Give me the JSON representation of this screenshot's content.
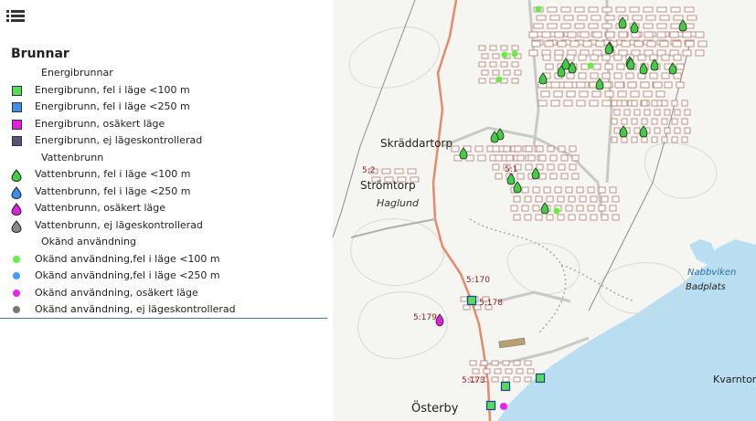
{
  "legend": {
    "title": "Brunnar",
    "items": [
      {
        "kind": "group",
        "label": "Energibrunnar"
      },
      {
        "kind": "square",
        "color": "#55dd55",
        "label": "Energibrunn, fel i läge <100 m"
      },
      {
        "kind": "square",
        "color": "#3d8ef0",
        "label": "Energibrunn, fel i läge <250 m"
      },
      {
        "kind": "square",
        "color": "#e020e0",
        "label": "Energibrunn, osäkert läge"
      },
      {
        "kind": "square",
        "color": "#555577",
        "label": "Energibrunn, ej lägeskontrollerad"
      },
      {
        "kind": "group",
        "label": "Vattenbrunn"
      },
      {
        "kind": "drop",
        "color": "#44cc44",
        "label": "Vattenbrunn, fel i läge <100 m"
      },
      {
        "kind": "drop",
        "color": "#3d8ef0",
        "label": "Vattenbrunn, fel i läge <250 m"
      },
      {
        "kind": "drop",
        "color": "#e020e0",
        "label": "Vattenbrunn, osäkert läge"
      },
      {
        "kind": "drop",
        "color": "#888888",
        "label": "Vattenbrunn, ej lägeskontrollerad"
      },
      {
        "kind": "group",
        "label": "Okänd användning"
      },
      {
        "kind": "dot",
        "color": "#66ee44",
        "label": "Okänd användning,fel i läge <100 m"
      },
      {
        "kind": "dot",
        "color": "#3d9ef0",
        "label": "Okänd användning,fel i läge <250 m"
      },
      {
        "kind": "dot",
        "color": "#ee22ee",
        "label": "Okänd användning, osäkert läge"
      },
      {
        "kind": "dot",
        "color": "#777777",
        "label": "Okänd användning, ej lägeskontrollerad"
      }
    ]
  },
  "map": {
    "places": {
      "skraddartorp": "Skräddartorp",
      "stromtorp": "Strömtorp",
      "haglund": "Haglund",
      "nabbviken": "Nabbviken",
      "badplats": "Badplats",
      "osterby": "Österby",
      "kvarntorp": "Kvarntorp"
    },
    "parcels": {
      "p52": "5:2",
      "p51": "5:1",
      "p5170": "5:170",
      "p5178": "5:178",
      "p5179": "5:179",
      "p5173": "5:173"
    },
    "colors": {
      "water": "#b9def2",
      "land": "#f5f5f2",
      "road": "#e58a6a",
      "path": "#9aa0a0",
      "label": "#222222",
      "parcel_label": "#8a1a1a",
      "water_label": "#2a6fa0"
    }
  }
}
